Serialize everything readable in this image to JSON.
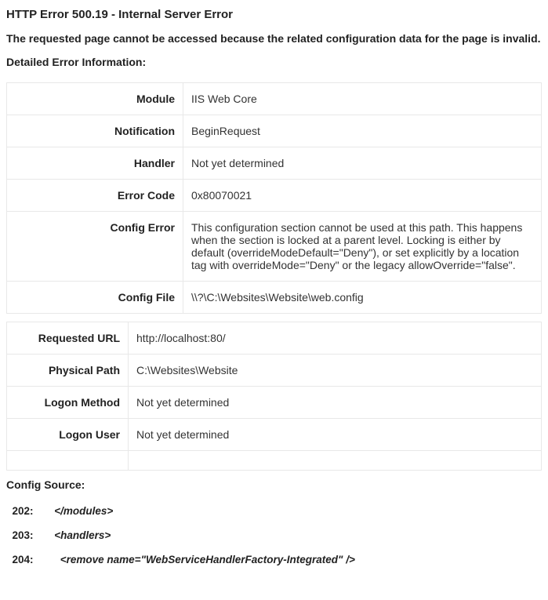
{
  "title": "HTTP Error 500.19 - Internal Server Error",
  "subtitle": "The requested page cannot be accessed because the related configuration data for the page is invalid.",
  "detailHeading": "Detailed Error Information:",
  "table1": {
    "module": {
      "label": "Module",
      "value": "IIS   Web Core"
    },
    "notification": {
      "label": "Notification",
      "value": "BeginRequest"
    },
    "handler": {
      "label": "Handler",
      "value": "Not   yet determined"
    },
    "errorCode": {
      "label": "Error Code",
      "value": "0x80070021"
    },
    "configError": {
      "label": "Config Error",
      "value": "   This   configuration section cannot be used at this path. This happens when the   section is locked at a parent level. Locking is either by default (overrideModeDefault=\"Deny\"), or set explicitly by a location tag   with overrideMode=\"Deny\" or the legacy   allowOverride=\"false\"."
    },
    "configFile": {
      "label": "Config File",
      "value": "   \\\\?\\C:\\Websites\\Website\\web.config"
    }
  },
  "table2": {
    "requestedUrl": {
      "label": "Requested URL",
      "value": "   http://localhost:80/"
    },
    "physicalPath": {
      "label": "Physical Path",
      "value": "   C:\\Websites\\Website"
    },
    "logonMethod": {
      "label": "Logon Method",
      "value": "   Not   yet determined"
    },
    "logonUser": {
      "label": "Logon User",
      "value": "   Not   yet determined"
    }
  },
  "configSource": {
    "heading": "Config Source:",
    "lines": {
      "l1": {
        "num": "  202:",
        "code": "   </modules>"
      },
      "l2": {
        "num": "  203:",
        "code": "   <handlers>"
      },
      "l3": {
        "num": "  204:",
        "code": "     <remove name=\"WebServiceHandlerFactory-Integrated\" />"
      }
    }
  }
}
